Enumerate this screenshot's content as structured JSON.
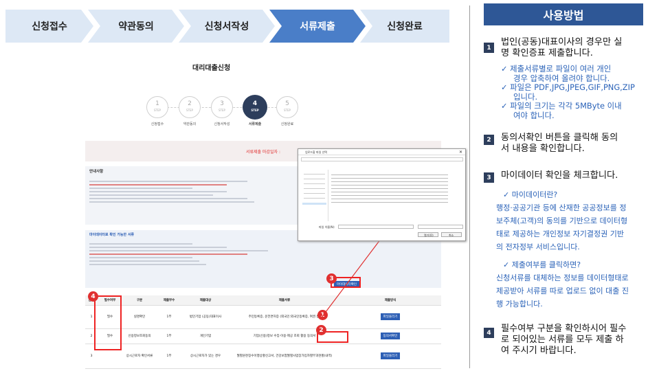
{
  "steps": [
    "신청접수",
    "약관동의",
    "신청서작성",
    "서류제출",
    "신청완료"
  ],
  "right_panel": {
    "title": "사용방법",
    "items": [
      {
        "num": "1",
        "lines": [
          "법인(공동)대표이사의 경우만 실",
          "명 확인증표 제출합니다."
        ]
      },
      {
        "num": "2",
        "lines": [
          "동의서확인 버튼을 클릭해 동의",
          "서 내용을 확인합니다."
        ]
      },
      {
        "num": "3",
        "lines": [
          "마이데이터 확인을 체크합니다."
        ]
      },
      {
        "num": "4",
        "lines": [
          "필수여부 구분을 확인하시어  필수",
          "로 되어있는 서류를 모두 제출 하",
          "여 주시기 바랍니다."
        ]
      }
    ],
    "sub1": [
      "✓  제출서류별로 파일이 여러 개인",
      "경우 압축하여 올려야 합니다.",
      "✓  파일은 PDF,JPG,JPEG,GIF,PNG,ZIP",
      "입니다.",
      "✓  파일의 크기는 각각 5MByte 이내",
      "여야 합니다."
    ],
    "blue1": [
      "✓  마이데이터란?",
      "행정·공공기관 등에 산재한 공공정보를 정",
      "보주체(고객)의 동의를 기반으로 데이터형",
      "태로 제공하는 개인정보 자기결정권 기반",
      "의 전자정부 서비스입니다."
    ],
    "blue2": [
      "✓  제출여부를 클릭하면?",
      "신청서류를 대체하는 정보를 데이터형태로",
      "제공받아 서류를 따로 업로드 없이 대출 진",
      "행 가능합니다."
    ]
  },
  "shot": {
    "title": "대리대출신청",
    "circles": [
      {
        "n": "1",
        "s": "STEP",
        "label": "신청접수"
      },
      {
        "n": "2",
        "s": "STEP",
        "label": "약관동의"
      },
      {
        "n": "3",
        "s": "STEP",
        "label": "신청서작성"
      },
      {
        "n": "4",
        "s": "STEP",
        "label": "서류제출"
      },
      {
        "n": "5",
        "s": "STEP",
        "label": "신청완료"
      }
    ],
    "deadline": "서류제출 마감일자 :",
    "notice_title": "안내사항",
    "mydata_title": "마이데이터로 확인 가능한 서류",
    "mydata_btn": "마이데이터확인",
    "table_headers": [
      "순번",
      "필수여부",
      "구분",
      "제출부수",
      "제출대상",
      "제출서류",
      "제출방식"
    ],
    "rows": [
      {
        "no": "1",
        "req": "필수",
        "type": "실명확인",
        "cnt": "1부",
        "target": "법인기업 (공동)대표이사",
        "doc": "주민등록증, 운전면허증 (외국인:외국인등록증, 여권 등)",
        "btn": "파일올리기"
      },
      {
        "no": "2",
        "req": "필수",
        "type": "신용정보조회동의",
        "cnt": "1부",
        "target": "개인기업",
        "doc": "기업(신용)정보 수집·이용·제공 조회 활용 동의서",
        "btn": "동의서확인"
      },
      {
        "no": "3",
        "req": "",
        "type": "상시근로자 확인서류",
        "cnt": "1부",
        "target": "상시근로자가 있는 경우",
        "doc": "월별원천징수이행상황신고서, 건강보험월별사업장가입자별부과현황(내역)",
        "btn": "파일올리기"
      }
    ],
    "badges": [
      "1",
      "2",
      "3",
      "4"
    ]
  },
  "dialog": {
    "title": "업로드할 파일 선택",
    "filename_label": "파일 이름(N):",
    "open_btn": "열기(O)",
    "cancel_btn": "취소"
  }
}
